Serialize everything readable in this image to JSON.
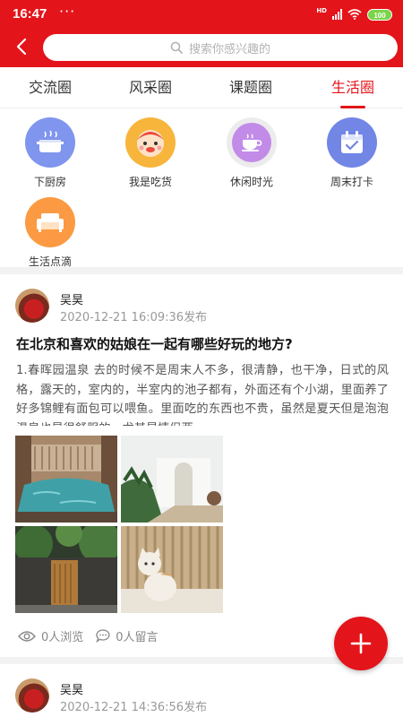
{
  "status_bar": {
    "time": "16:47",
    "dots": "···",
    "battery": "100"
  },
  "search": {
    "placeholder": "搜索你感兴趣的"
  },
  "tabs": [
    {
      "label": "交流圈",
      "active": false
    },
    {
      "label": "风采圈",
      "active": false
    },
    {
      "label": "课题圈",
      "active": false
    },
    {
      "label": "生活圈",
      "active": true
    }
  ],
  "categories": [
    {
      "label": "下厨房",
      "icon": "cooking-pot-icon",
      "color": "#7f95ee"
    },
    {
      "label": "我是吃货",
      "icon": "foodie-mascot-icon",
      "color": "#f7b53c"
    },
    {
      "label": "休闲时光",
      "icon": "coffee-cup-icon",
      "color": "#c28be8"
    },
    {
      "label": "周末打卡",
      "icon": "calendar-check-icon",
      "color": "#7286e6"
    },
    {
      "label": "生活点滴",
      "icon": "sofa-icon",
      "color": "#fb9a42"
    }
  ],
  "posts": [
    {
      "user": "吴昊",
      "time": "2020-12-21 16:09:36发布",
      "title": "在北京和喜欢的姑娘在一起有哪些好玩的地方?",
      "body": "1.春晖园温泉 去的时候不是周末人不多，很清静，也干净，日式的风格，露天的，室内的，半室内的池子都有，外面还有个小湖，里面养了好多锦鲤有面包可以喂鱼。里面吃的东西也不贵，虽然是夏天但是泡泡温泉也是很舒服的，尤其是情侣两…",
      "views": "0人浏览",
      "comments": "0人留言"
    },
    {
      "user": "吴昊",
      "time": "2020-12-21 14:36:56发布"
    }
  ],
  "colors": {
    "brand": "#e4141b"
  }
}
